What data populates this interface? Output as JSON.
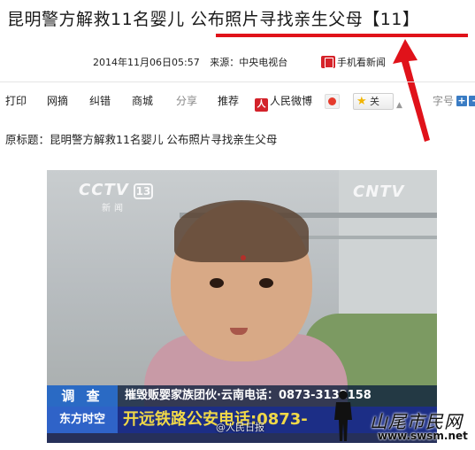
{
  "article": {
    "headline": "昆明警方解救11名婴儿 公布照片寻找亲生父母【11】",
    "datetime": "2014年11月06日05:57",
    "source": "来源：中央电视台",
    "mobile_news": "手机看新闻",
    "original_title": "原标题：昆明警方解救11名婴儿 公布照片寻找亲生父母"
  },
  "toolbar": {
    "print": "打印",
    "bookmark": "网摘",
    "correct": "纠错",
    "mall": "商城",
    "share": "分享",
    "recommend": "推荐",
    "people_weibo": "人民微博",
    "follow": "关",
    "font_size": "字号"
  },
  "video": {
    "channel_logo": "CCTV",
    "channel_number": "13",
    "channel_sub": "新闻",
    "site_logo": "CNTV",
    "caption_tag": "调 查",
    "caption_text": "摧毁贩婴家族团伙·云南电话：0873-3132158",
    "ticker_tag": "东方时空",
    "ticker_text": "开远铁路公安电话:0873-",
    "weibo_watermark": "@人民日报"
  },
  "watermark": {
    "site_name": "山尾市民网",
    "site_url": "www.swsm.net"
  },
  "colors": {
    "highlight_red": "#e0121a",
    "ticker_blue": "#1c2e86",
    "ticker_yellow": "#f0d848"
  }
}
